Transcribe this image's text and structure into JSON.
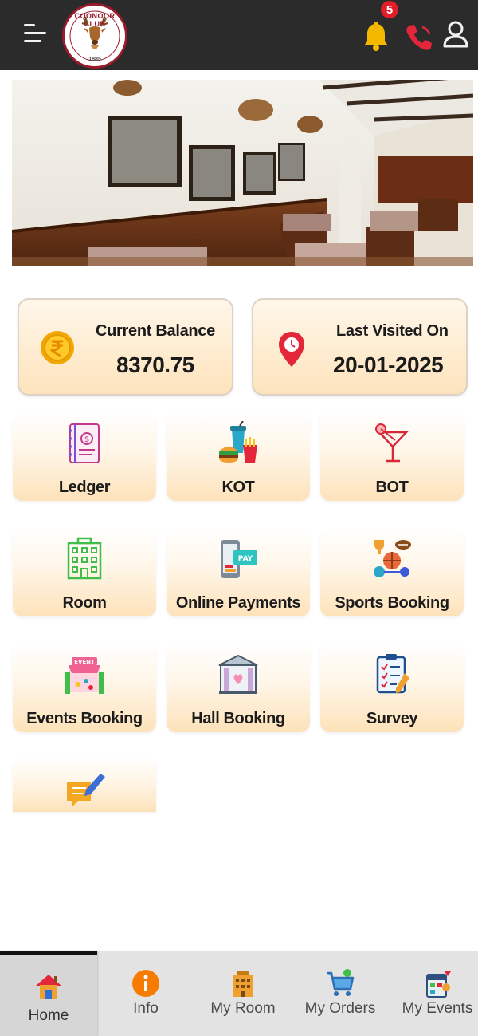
{
  "header": {
    "logo_name": "COONOOR CLUB",
    "logo_year": "1885",
    "notification_count": "5",
    "icons": {
      "menu": "hamburger-menu-icon",
      "bell": "bell-icon",
      "phone": "phone-icon",
      "user": "user-icon"
    }
  },
  "summary": {
    "balance": {
      "title": "Current Balance",
      "value": "8370.75",
      "icon": "rupee-coin-icon"
    },
    "visited": {
      "title": "Last Visited On",
      "value": "20-01-2025",
      "icon": "location-pin-icon"
    }
  },
  "tiles": [
    {
      "label": "Ledger",
      "icon": "ledger-book-icon"
    },
    {
      "label": "KOT",
      "icon": "food-drink-icon"
    },
    {
      "label": "BOT",
      "icon": "cocktail-icon"
    },
    {
      "label": "Room",
      "icon": "building-icon"
    },
    {
      "label": "Online Payments",
      "icon": "mobile-payment-icon"
    },
    {
      "label": "Sports Booking",
      "icon": "sports-icon"
    },
    {
      "label": "Events Booking",
      "icon": "event-icon"
    },
    {
      "label": "Hall Booking",
      "icon": "hall-icon"
    },
    {
      "label": "Survey",
      "icon": "clipboard-survey-icon"
    },
    {
      "label": "",
      "icon": "feedback-icon"
    }
  ],
  "nav": [
    {
      "label": "Home",
      "icon": "home-icon",
      "active": true
    },
    {
      "label": "Info",
      "icon": "info-icon"
    },
    {
      "label": "My Room",
      "icon": "hotel-icon"
    },
    {
      "label": "My Orders",
      "icon": "cart-icon"
    },
    {
      "label": "My Events",
      "icon": "calendar-events-icon"
    }
  ],
  "colors": {
    "header_bg": "#2b2b2b",
    "accent_orange": "#fde2b9",
    "badge_red": "#e11d2a",
    "bell_yellow": "#f5b800",
    "phone_red": "#e3263a"
  }
}
